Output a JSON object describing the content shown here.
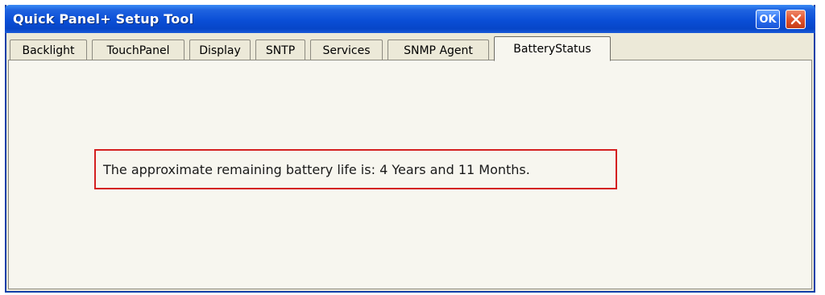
{
  "window": {
    "title": "Quick Panel+ Setup Tool",
    "ok_label": "OK",
    "close_icon": "close-icon"
  },
  "tabs": [
    {
      "label": "Backlight",
      "active": false
    },
    {
      "label": "TouchPanel",
      "active": false
    },
    {
      "label": "Display",
      "active": false
    },
    {
      "label": "SNTP",
      "active": false
    },
    {
      "label": "Services",
      "active": false
    },
    {
      "label": "SNMP Agent",
      "active": false
    },
    {
      "label": "BatteryStatus",
      "active": true
    }
  ],
  "battery_status": {
    "message": "The approximate remaining battery life is: 4 Years and 11 Months."
  },
  "colors": {
    "titlebar": "#0a4ed6",
    "highlight_border": "#d42020",
    "panel_background": "#f7f6ef"
  }
}
